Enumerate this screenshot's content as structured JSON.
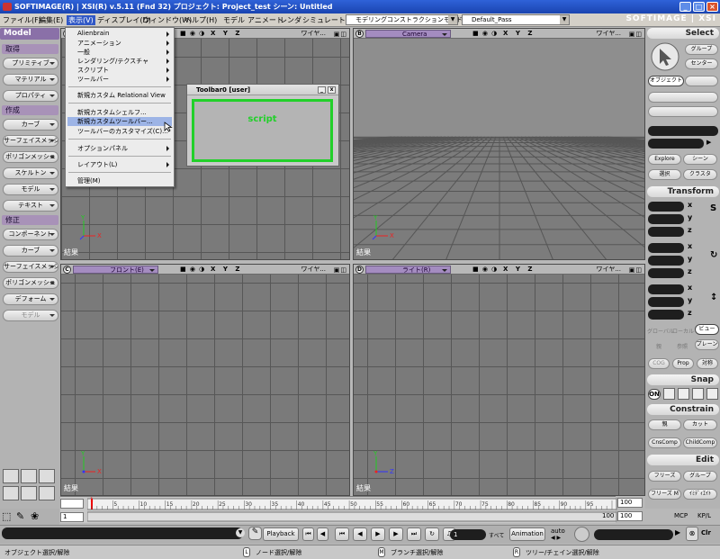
{
  "window": {
    "title": "SOFTIMAGE(R) | XSI(R) v.5.11 (Fnd 32) プロジェクト: Project_test    シーン: Untitled",
    "btn_min": "_",
    "btn_max": "□",
    "btn_close": "×"
  },
  "menubar": {
    "items": [
      "ファイル(F)",
      "編集(E)",
      "表示(V)",
      "ディスプレイ(D)",
      "ウィンドウ(W)",
      "ヘルプ(H)",
      "モデル",
      "アニメート",
      "レンダ",
      "シミュレート"
    ],
    "mode": "モデリングコンストラクションモード",
    "pass": "Default_Pass",
    "logo": "SOFTIMAGE | XSI"
  },
  "left_panel": {
    "model_label": "Model",
    "sections": [
      {
        "label": "取得",
        "buttons": [
          "プリミティブ",
          "マテリアル",
          "プロパティ"
        ]
      },
      {
        "label": "作成",
        "buttons": [
          "カーブ",
          "サーフェイスメッシュ",
          "ポリゴンメッシュ",
          "スケルトン",
          "モデル",
          "テキスト"
        ]
      },
      {
        "label": "修正",
        "buttons": [
          "コンポーネント",
          "カーブ",
          "サーフェイスメッシュ",
          "ポリゴンメッシュ",
          "デフォーム",
          "モデル"
        ]
      }
    ]
  },
  "view_menu": {
    "items": [
      {
        "label": "Alienbrain",
        "sub": true
      },
      {
        "label": "アニメーション",
        "sub": true
      },
      {
        "label": "一般",
        "sub": true
      },
      {
        "label": "レンダリング/テクスチャ",
        "sub": true
      },
      {
        "label": "スクリプト",
        "sub": true
      },
      {
        "label": "ツールバー",
        "sub": true
      },
      {
        "label": "新規カスタム Relational View",
        "sub": false
      },
      {
        "label": "新規カスタムシェルフ...",
        "sub": false
      },
      {
        "label": "新規カスタムツールバー...",
        "sub": false,
        "highlight": true
      },
      {
        "label": "ツールバーのカスタマイズ(C)...",
        "sub": false
      },
      {
        "label": "オプションパネル",
        "sub": true
      },
      {
        "label": "レイアウト(L)",
        "sub": true
      },
      {
        "label": "管理(M)",
        "sub": false
      }
    ]
  },
  "toolbar_window": {
    "title": "Toolbar0 [user]",
    "content": "script",
    "btn_min": "_",
    "btn_close": "x"
  },
  "viewports": [
    {
      "letter": "A",
      "camera": "",
      "label": "結果",
      "xyz": "X Y Z",
      "wire": "ワイヤ..."
    },
    {
      "letter": "B",
      "camera": "Camera",
      "label": "結果",
      "xyz": "X Y Z",
      "wire": "ワイヤ..."
    },
    {
      "letter": "C",
      "camera": "フロント(E)",
      "label": "結果",
      "xyz": "X Y Z",
      "wire": "ワイヤ..."
    },
    {
      "letter": "D",
      "camera": "ライト(R)",
      "label": "結果",
      "xyz": "X Y Z",
      "wire": "ワイヤ..."
    }
  ],
  "right_panel": {
    "select": "Select",
    "group": "グループ",
    "center": "センター",
    "object": "オブジェクト",
    "explore": "Explore",
    "scene": "シーン",
    "select_btn": "選択",
    "class_btn": "クラスタ",
    "transform": "Transform",
    "axes": [
      "x",
      "y",
      "z"
    ],
    "global": "グローバル",
    "local": "ローカル",
    "view": "ビュー",
    "ref": "参照",
    "plane": "プレーン",
    "cog": "COG",
    "prop": "Prop",
    "sym": "対称",
    "snap": "Snap",
    "snap_on": "ON",
    "constrain": "Constrain",
    "link": "親",
    "cut": "カット",
    "cnscomp": "CnsComp",
    "childcomp": "ChildComp",
    "edit": "Edit",
    "freeze": "フリーズ",
    "group2": "グループ",
    "freezem": "フリーズ M",
    "immed": "ｲﾐﾃﾞｨｴｲﾄ",
    "mcp": "MCP",
    "kpl": "KP/L"
  },
  "timeline": {
    "start": "1",
    "end": "100",
    "ticks": [
      "5",
      "10",
      "15",
      "20",
      "25",
      "30",
      "35",
      "40",
      "45",
      "50",
      "55",
      "60",
      "65",
      "70",
      "75",
      "80",
      "85",
      "90",
      "95"
    ],
    "current": "1",
    "range_end": "100",
    "range_end2": "100"
  },
  "bottom": {
    "playback": "Playback",
    "all": "すべて",
    "animation": "Animation",
    "auto": "auto",
    "clr": "Clr",
    "frame": "1"
  },
  "status": {
    "left": "オブジェクト選択/解除",
    "l_label": "L",
    "l_text": "ノード選択/解除",
    "m_label": "M",
    "m_text": "ブランチ選択/解除",
    "r_label": "R",
    "r_text": "ツリー/チェイン選択/解除"
  },
  "colors": {
    "menu_highlight": "#9db4e6",
    "script_border": "#22d02a",
    "section_header": "#a892b8"
  }
}
